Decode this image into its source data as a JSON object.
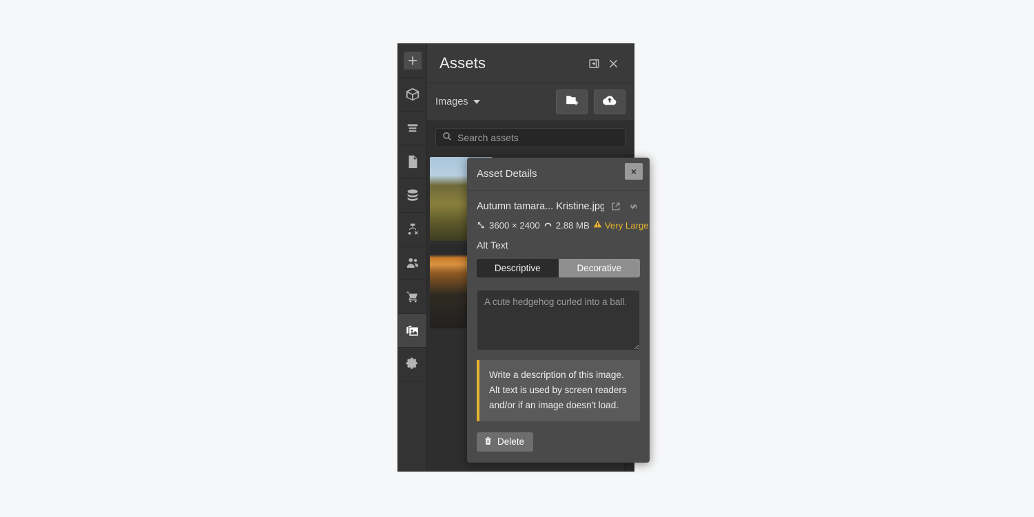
{
  "sidebar": {
    "items": [
      {
        "name": "add",
        "icon": "plus-icon",
        "active": false,
        "boxed": true
      },
      {
        "name": "models",
        "icon": "cube-icon",
        "active": false,
        "boxed": false
      },
      {
        "name": "content",
        "icon": "list-icon",
        "active": false,
        "boxed": false
      },
      {
        "name": "pages",
        "icon": "page-icon",
        "active": false,
        "boxed": false
      },
      {
        "name": "data",
        "icon": "database-icon",
        "active": false,
        "boxed": false
      },
      {
        "name": "structure",
        "icon": "sitemap-icon",
        "active": false,
        "boxed": false
      },
      {
        "name": "users",
        "icon": "users-icon",
        "active": false,
        "boxed": false
      },
      {
        "name": "commerce",
        "icon": "cart-icon",
        "active": false,
        "boxed": false
      },
      {
        "name": "assets",
        "icon": "images-icon",
        "active": true,
        "boxed": false
      },
      {
        "name": "settings",
        "icon": "gear-icon",
        "active": false,
        "boxed": false
      }
    ]
  },
  "panel": {
    "title": "Assets",
    "collapse_icon": "collapse-panel-icon",
    "close_icon": "close-icon"
  },
  "toolbar": {
    "kind_label": "Images",
    "kind_caret_icon": "chevron-down-icon",
    "new_folder_icon": "new-folder-icon",
    "upload_icon": "cloud-upload-icon"
  },
  "search": {
    "placeholder": "Search assets",
    "value": "",
    "icon": "search-icon"
  },
  "modal": {
    "title": "Asset Details",
    "close_label": "×",
    "file_name": "Autumn tamara... Kristine.jpg",
    "open_external_icon": "external-link-icon",
    "copy_link_icon": "link-icon",
    "dimensions_icon": "resize-diagonal-icon",
    "dimensions": "3600 × 2400",
    "filesize_icon": "gauge-icon",
    "filesize": "2.88 MB",
    "size_warning_icon": "warning-triangle-icon",
    "size_warning": "Very Large",
    "alt_text_label": "Alt Text",
    "alt_modes": [
      {
        "label": "Descriptive",
        "selected": true
      },
      {
        "label": "Decorative",
        "selected": false
      }
    ],
    "alt_placeholder": "A cute hedgehog curled into a ball.",
    "alt_value": "",
    "hint": "Write a description of this image. Alt text is used by screen readers and/or if an image doesn't load.",
    "delete_label": "Delete",
    "delete_icon": "trash-icon"
  },
  "colors": {
    "panel_bg": "#2e2e2e",
    "header_bg": "#3a3a3a",
    "rail_bg": "#333333",
    "modal_bg": "#4a4a4a",
    "accent_warning": "#e6b32e",
    "text_primary": "#ededed",
    "text_muted": "#9b9b9b"
  }
}
